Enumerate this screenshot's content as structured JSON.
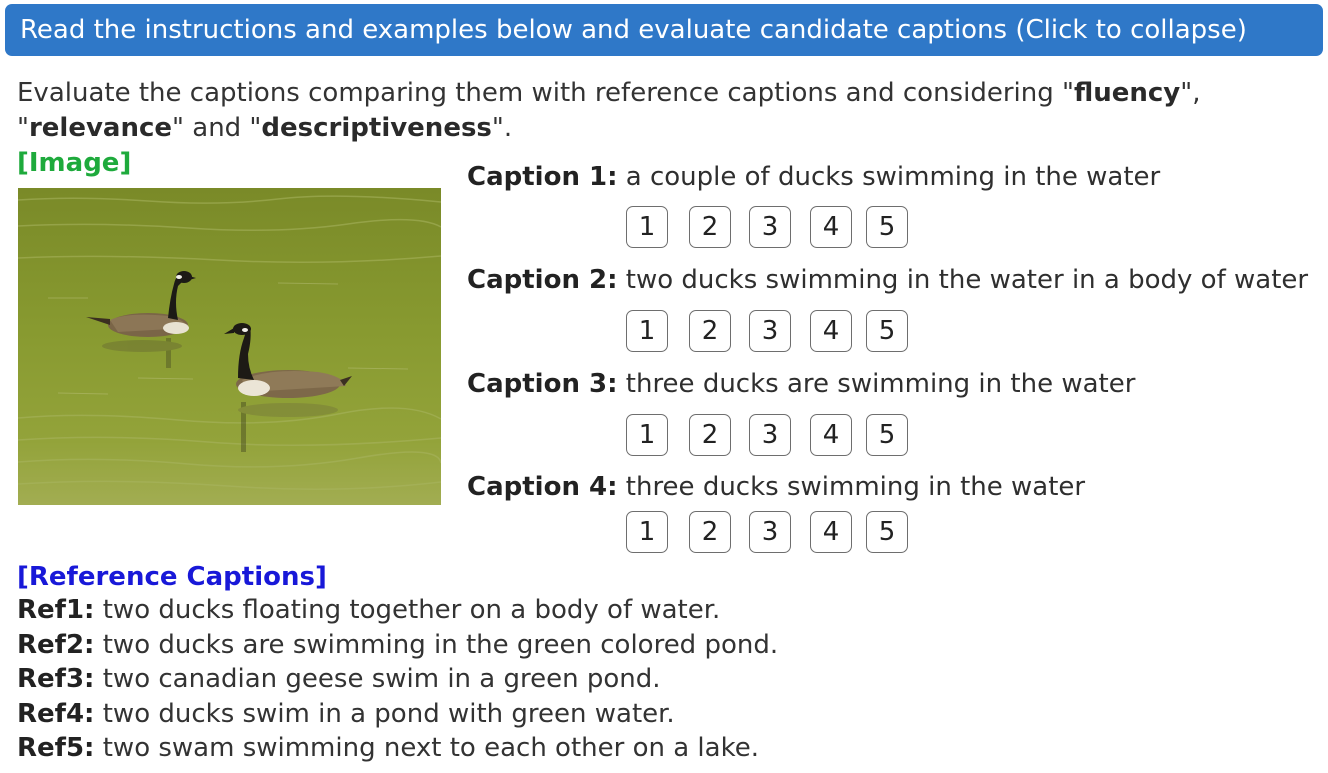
{
  "header": {
    "title": "Read the instructions and examples below and evaluate candidate captions (Click to collapse)"
  },
  "instructions": {
    "pre": "Evaluate the captions comparing them with reference captions and considering \"",
    "fluency": "fluency",
    "mid1": "\", \"",
    "relevance": "relevance",
    "mid2": "\" and \"",
    "descriptiveness": "descriptiveness",
    "post": "\"."
  },
  "image_label": "[Image]",
  "captions": [
    {
      "label": "Caption 1:",
      "text": "a couple of ducks swimming in the water"
    },
    {
      "label": "Caption 2:",
      "text": "two ducks swimming in the water in a body of water"
    },
    {
      "label": "Caption 3:",
      "text": "three ducks are swimming in the water"
    },
    {
      "label": "Caption 4:",
      "text": "three ducks swimming in the water"
    }
  ],
  "rating_options": [
    "1",
    "2",
    "3",
    "4",
    "5"
  ],
  "references": {
    "title": "[Reference Captions]",
    "items": [
      {
        "label": "Ref1:",
        "text": "two ducks floating together on a body of water."
      },
      {
        "label": "Ref2:",
        "text": "two ducks are swimming in the green colored pond."
      },
      {
        "label": "Ref3:",
        "text": "two canadian geese swim in a green pond."
      },
      {
        "label": "Ref4:",
        "text": "two ducks swim in a pond with green water."
      },
      {
        "label": "Ref5:",
        "text": "two swam swimming next to each other on a lake."
      }
    ]
  },
  "colors": {
    "header_bg": "#2f78c8",
    "image_label": "#1eaa3c",
    "ref_title": "#1818d8"
  }
}
